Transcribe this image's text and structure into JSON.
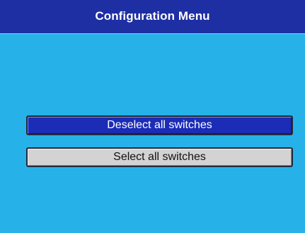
{
  "window": {
    "title": "Configuration Menu"
  },
  "menu": {
    "items": [
      {
        "label": "Deselect all switches",
        "state": "highlighted"
      },
      {
        "label": "Select all switches",
        "state": "normal"
      }
    ]
  },
  "colors": {
    "title_bar": "#1e2fa4",
    "background": "#26b2e8",
    "highlighted_button": "#1b2cb7",
    "normal_button": "#d3d3d3"
  }
}
